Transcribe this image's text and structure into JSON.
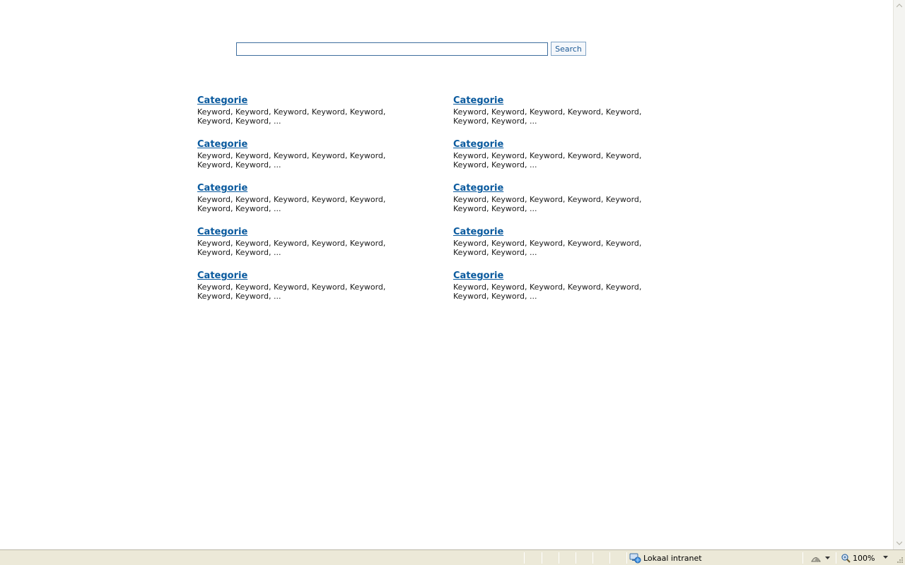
{
  "search": {
    "value": "",
    "button_label": "Search"
  },
  "categories": [
    {
      "title": "Categorie",
      "keywords": "Keyword, Keyword, Keyword, Keyword, Keyword, Keyword, Keyword,  ..."
    },
    {
      "title": "Categorie",
      "keywords": "Keyword, Keyword, Keyword, Keyword, Keyword, Keyword, Keyword,  ..."
    },
    {
      "title": "Categorie",
      "keywords": "Keyword, Keyword, Keyword, Keyword, Keyword, Keyword, Keyword,  ..."
    },
    {
      "title": "Categorie",
      "keywords": "Keyword, Keyword, Keyword, Keyword, Keyword, Keyword, Keyword,  ..."
    },
    {
      "title": "Categorie",
      "keywords": "Keyword, Keyword, Keyword, Keyword, Keyword, Keyword, Keyword,  ..."
    },
    {
      "title": "Categorie",
      "keywords": "Keyword, Keyword, Keyword, Keyword, Keyword, Keyword, Keyword,  ..."
    },
    {
      "title": "Categorie",
      "keywords": "Keyword, Keyword, Keyword, Keyword, Keyword, Keyword, Keyword,  ..."
    },
    {
      "title": "Categorie",
      "keywords": "Keyword, Keyword, Keyword, Keyword, Keyword, Keyword, Keyword,  ..."
    },
    {
      "title": "Categorie",
      "keywords": "Keyword, Keyword, Keyword, Keyword, Keyword, Keyword, Keyword,  ..."
    },
    {
      "title": "Categorie",
      "keywords": "Keyword, Keyword, Keyword, Keyword, Keyword, Keyword, Keyword,  ..."
    }
  ],
  "status_bar": {
    "zone_label": "Lokaal intranet",
    "zoom_label": "100%"
  },
  "icons": {
    "zone": "intranet-globe-icon",
    "protected_mode": "protected-mode-icon",
    "zoom": "magnifier-icon"
  },
  "colors": {
    "link": "#0a5a9e",
    "input_border": "#3f6e9e",
    "status_bar_bg": "#ece9d8"
  }
}
